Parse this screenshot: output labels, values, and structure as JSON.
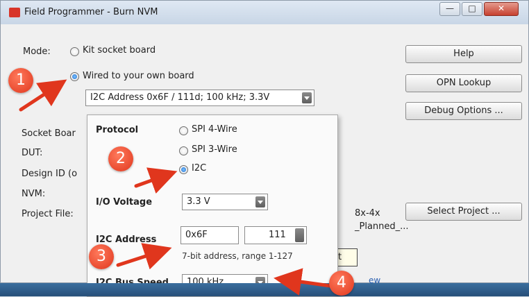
{
  "window": {
    "title": "Field Programmer - Burn NVM"
  },
  "main": {
    "mode_label": "Mode:",
    "mode_options": [
      "Kit socket board",
      "Wired to your own board"
    ],
    "address_combo_value": "I2C Address 0x6F / 111d; 100 kHz; 3.3V",
    "left_labels": [
      "Socket Boar",
      "DUT:",
      "Design ID (o",
      "NVM:",
      "Project File:"
    ],
    "partial_texts": [
      "8x-4x",
      "_Planned_...",
      "t",
      "ew"
    ]
  },
  "buttons": {
    "help": "Help",
    "opn_lookup": "OPN Lookup",
    "debug_options": "Debug Options ...",
    "select_project": "Select Project ..."
  },
  "panel": {
    "protocol_label": "Protocol",
    "protocol_options": [
      "SPI 4-Wire",
      "SPI 3-Wire",
      "I2C"
    ],
    "io_voltage_label": "I/O Voltage",
    "io_voltage_value": "3.3 V",
    "i2c_address_label": "I2C Address",
    "i2c_address_hex": "0x6F",
    "i2c_address_dec": "111",
    "i2c_address_hint": "7-bit address, range 1-127",
    "bus_speed_label": "I2C Bus Speed",
    "bus_speed_value": "100 kHz"
  },
  "callouts": [
    "1",
    "2",
    "3",
    "4"
  ],
  "colors": {
    "callout": "#e0361d",
    "radio_selected": "#1f6fd1",
    "titlebar": "#c8d6e6"
  }
}
